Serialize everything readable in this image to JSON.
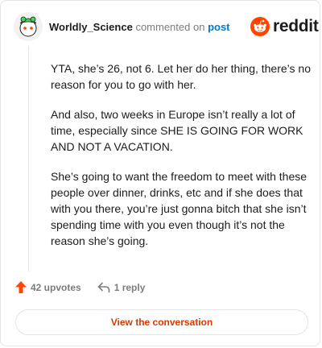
{
  "comment": {
    "author": "Worldly_Science",
    "action_text": "commented on",
    "post_link_label": "post",
    "paragraphs": [
      "YTA, she’s 26, not 6. Let her do her thing, there’s no reason for you to go with her.",
      "And also, two weeks in Europe isn’t really a lot of time, especially since SHE IS GOING FOR WORK AND NOT A VACATION.",
      "She’s going to want the freedom to meet with these people over dinner, drinks, etc and if she does that with you there, you’re just gonna bitch that she isn’t spending time with you even though it’s not the reason she’s going."
    ],
    "upvotes_label": "42 upvotes",
    "replies_label": "1 reply"
  },
  "brand": {
    "wordmark": "reddit",
    "accent_color": "#ff4500"
  },
  "cta": {
    "label": "View the conversation",
    "color": "#d93a00"
  },
  "icons": {
    "avatar": "snoo-avatar-icon",
    "logo": "reddit-snoo-logo-icon",
    "upvote": "upvote-arrow-icon",
    "reply": "reply-arrow-icon"
  }
}
